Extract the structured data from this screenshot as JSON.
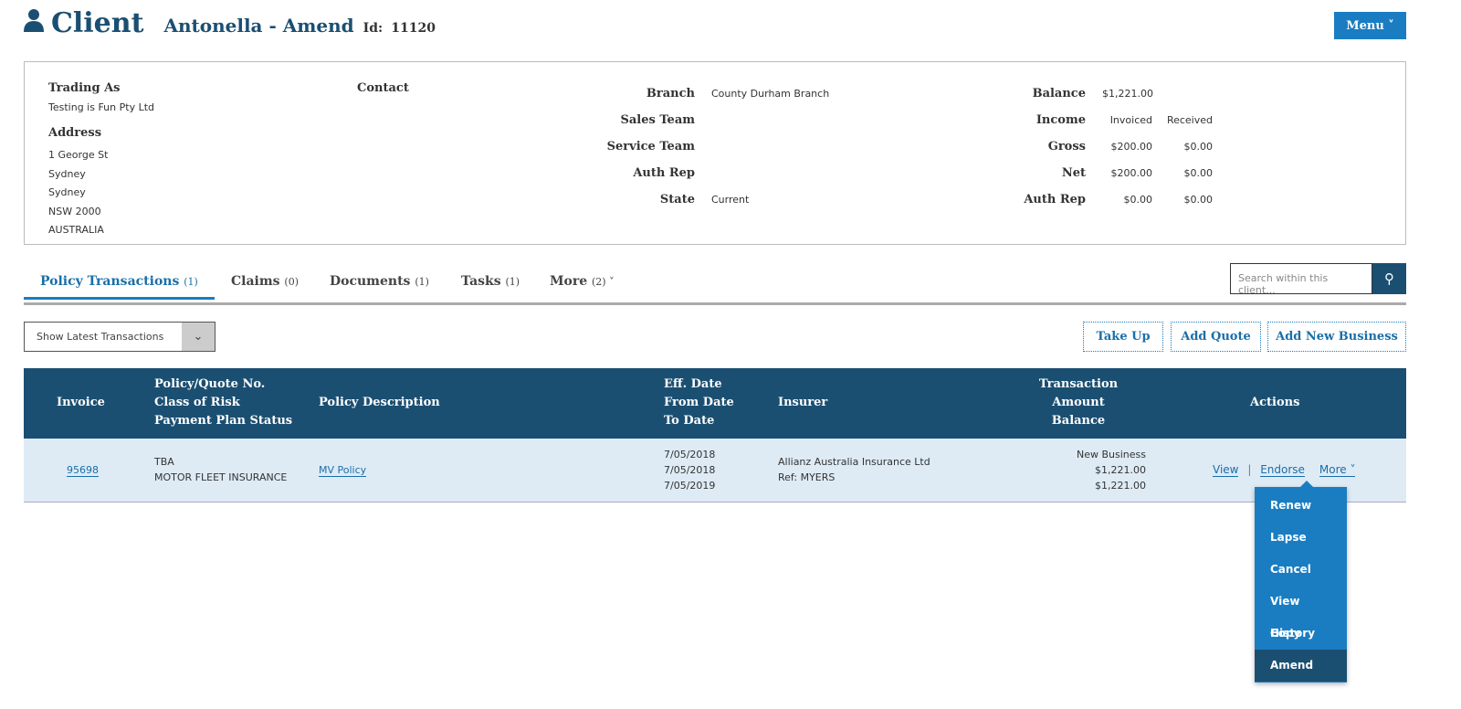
{
  "header": {
    "title": "Client",
    "name": "Antonella - Amend",
    "id_label": "Id:",
    "id": "11120",
    "menu": "Menu ˅"
  },
  "panel": {
    "trading_as_label": "Trading As",
    "trading_as": "Testing is Fun Pty Ltd",
    "address_label": "Address",
    "address": [
      "1 George St",
      "Sydney",
      "Sydney",
      "NSW 2000",
      "AUSTRALIA"
    ],
    "contact_label": "Contact",
    "mid": [
      {
        "label": "Branch",
        "value": "County Durham Branch"
      },
      {
        "label": "Sales Team",
        "value": ""
      },
      {
        "label": "Service Team",
        "value": ""
      },
      {
        "label": "Auth Rep",
        "value": ""
      },
      {
        "label": "State",
        "value": "Current"
      }
    ],
    "balance_label": "Balance",
    "balance": "$1,221.00",
    "income_label": "Income",
    "invoiced": "Invoiced",
    "received": "Received",
    "fin": [
      {
        "label": "Gross",
        "inv": "$200.00",
        "rec": "$0.00"
      },
      {
        "label": "Net",
        "inv": "$200.00",
        "rec": "$0.00"
      },
      {
        "label": "Auth Rep",
        "inv": "$0.00",
        "rec": "$0.00"
      }
    ]
  },
  "tabs": [
    {
      "label": "Policy Transactions",
      "count": "(1)"
    },
    {
      "label": "Claims",
      "count": "(0)"
    },
    {
      "label": "Documents",
      "count": "(1)"
    },
    {
      "label": "Tasks",
      "count": "(1)"
    },
    {
      "label": "More",
      "count": "(2) ˅"
    }
  ],
  "search": {
    "placeholder": "Search within this client..."
  },
  "filter": "Show Latest Transactions",
  "buttons": {
    "take_up": "Take Up",
    "add_quote": "Add Quote",
    "add_new": "Add New Business"
  },
  "table": {
    "headers": {
      "invoice": "Invoice",
      "policy": [
        "Policy/Quote No.",
        "Class of Risk",
        "Payment Plan Status"
      ],
      "desc": "Policy Description",
      "dates": [
        "Eff. Date",
        "From Date",
        "To Date"
      ],
      "insurer": "Insurer",
      "amount": [
        "Transaction",
        "Amount",
        "Balance"
      ],
      "actions": "Actions"
    },
    "rows": [
      {
        "invoice": "95698",
        "policy": "TBA",
        "class": "MOTOR FLEET INSURANCE",
        "desc": "MV Policy",
        "eff": "7/05/2018",
        "from": "7/05/2018",
        "to": "7/05/2019",
        "insurer": "Allianz Australia Insurance Ltd",
        "ref": "Ref: MYERS",
        "type": "New Business",
        "amount": "$1,221.00",
        "balance": "$1,221.00",
        "view": "View",
        "endorse": "Endorse",
        "more": "More ˅"
      }
    ]
  },
  "dropdown": [
    "Renew",
    "Lapse",
    "Cancel",
    "View History",
    "Copy",
    "Amend"
  ]
}
